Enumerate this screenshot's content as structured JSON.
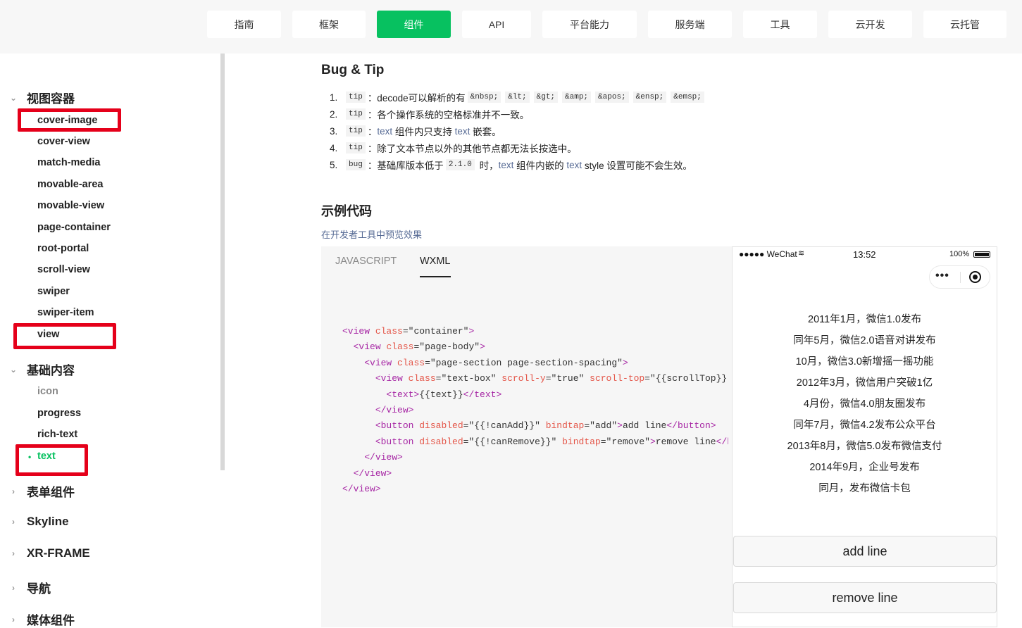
{
  "nav": [
    "指南",
    "框架",
    "组件",
    "API",
    "平台能力",
    "服务端",
    "工具",
    "云开发",
    "云托管"
  ],
  "sidebar": {
    "groups": [
      "视图容器",
      "基础内容",
      "表单组件",
      "Skyline",
      "XR-FRAME",
      "导航",
      "媒体组件"
    ],
    "view_container_items": [
      "cover-image",
      "cover-view",
      "match-media",
      "movable-area",
      "movable-view",
      "page-container",
      "root-portal",
      "scroll-view",
      "swiper",
      "swiper-item",
      "view"
    ],
    "basic_items": [
      "icon",
      "progress",
      "rich-text",
      "text"
    ]
  },
  "content": {
    "bug_tip_title": "Bug & Tip",
    "tips": {
      "t1_tag": "tip",
      "t1_text": "：decode可以解析的有",
      "t1_codes": [
        "&nbsp;",
        "&lt;",
        "&gt;",
        "&amp;",
        "&apos;",
        "&ensp;",
        "&emsp;"
      ],
      "t2_tag": "tip",
      "t2_text": "：各个操作系统的空格标准并不一致。",
      "t3_tag": "tip",
      "t3_a": "：",
      "t3_link1": "text",
      "t3_b": " 组件内只支持 ",
      "t3_link2": "text",
      "t3_c": " 嵌套。",
      "t4_tag": "tip",
      "t4_text": "：除了文本节点以外的其他节点都无法长按选中。",
      "t5_tag": "bug",
      "t5_a": "：基础库版本低于",
      "t5_code": "2.1.0",
      "t5_b": " 时，",
      "t5_link1": "text",
      "t5_c": " 组件内嵌的 ",
      "t5_link2": "text",
      "t5_d": " style 设置可能不会生效。"
    },
    "example_title": "示例代码",
    "preview_link": "在开发者工具中预览效果",
    "tabs": [
      "JAVASCRIPT",
      "WXML"
    ]
  },
  "phone": {
    "carrier": "●●●●● WeChat",
    "time": "13:52",
    "battery": "100%",
    "lines": [
      "2011年1月，微信1.0发布",
      "同年5月，微信2.0语音对讲发布",
      "10月，微信3.0新增摇一摇功能",
      "2012年3月，微信用户突破1亿",
      "4月份，微信4.0朋友圈发布",
      "同年7月，微信4.2发布公众平台",
      "2013年8月，微信5.0发布微信支付",
      "2014年9月，企业号发布",
      "同月，发布微信卡包"
    ],
    "add_button": "add line",
    "remove_button": "remove line"
  },
  "colors": {
    "accent": "#07c160",
    "highlight_box": "#e5001a",
    "link": "#576b95"
  }
}
